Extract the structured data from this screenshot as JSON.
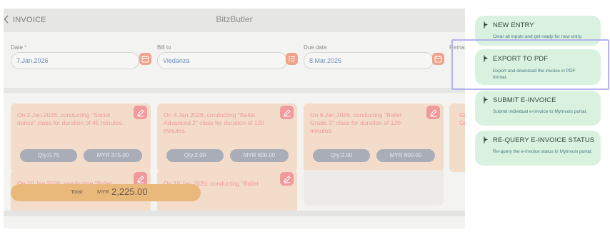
{
  "header": {
    "back_label": "INVOICE",
    "app_title": "BitzButler"
  },
  "form": {
    "date": {
      "label": "Date",
      "required_mark": "*",
      "value": "7.Jan.2026"
    },
    "bill_to": {
      "label": "Bill to",
      "value": "Viedanza"
    },
    "due_date": {
      "label": "Due date",
      "value": "8.Mar.2026"
    },
    "remarks": {
      "label": "Remar"
    }
  },
  "line_items": [
    {
      "desc": "On 2.Jan.2026: conducting \"Social dance\" class for duration of 45 minutes.",
      "qty": "Qty:0.75",
      "amount": "MYR 375.00"
    },
    {
      "desc": "On 4.Jan.2026: conducting \"Ballet Advanced 2\" class for duration of 120 minutes.",
      "qty": "Qty:2.00",
      "amount": "MYR 600.00"
    },
    {
      "desc": "On 6.Jan.2026: conducting \"Ballet Grade 3\" class for duration of 120 minutes.",
      "qty": "Qty:2.00",
      "amount": "MYR 600.00"
    },
    {
      "desc": "On 10.Jan.2026: conducting \"Ballet",
      "qty": "",
      "amount": ""
    },
    {
      "desc": "On 18.Jan.2026: conducting \"Ballet",
      "qty": "",
      "amount": ""
    }
  ],
  "partial_card_text": "Gr\nGr",
  "total": {
    "label": "Total:",
    "currency": "MYR",
    "amount": "2,225.00"
  },
  "actions": [
    {
      "title": "NEW ENTRY",
      "subtitle": "Clear all inputs and get ready for new entry."
    },
    {
      "title": "EXPORT TO PDF",
      "subtitle": "Export and download the invoice in PDF format."
    },
    {
      "title": "SUBMIT E-INVOICE",
      "subtitle": "Submit individual e-Invoice to MyInvois portal."
    },
    {
      "title": "RE-QUERY E-INVOICE STATUS",
      "subtitle": "Re-query the e-Invoice status in MyInvois portal."
    }
  ],
  "colors": {
    "accent_green": "#d9f1df",
    "card_bg": "#f4dccb",
    "edit_button": "#f09a9b",
    "total_bar": "#e9b87b",
    "selection_outline": "#b4b2ee"
  }
}
